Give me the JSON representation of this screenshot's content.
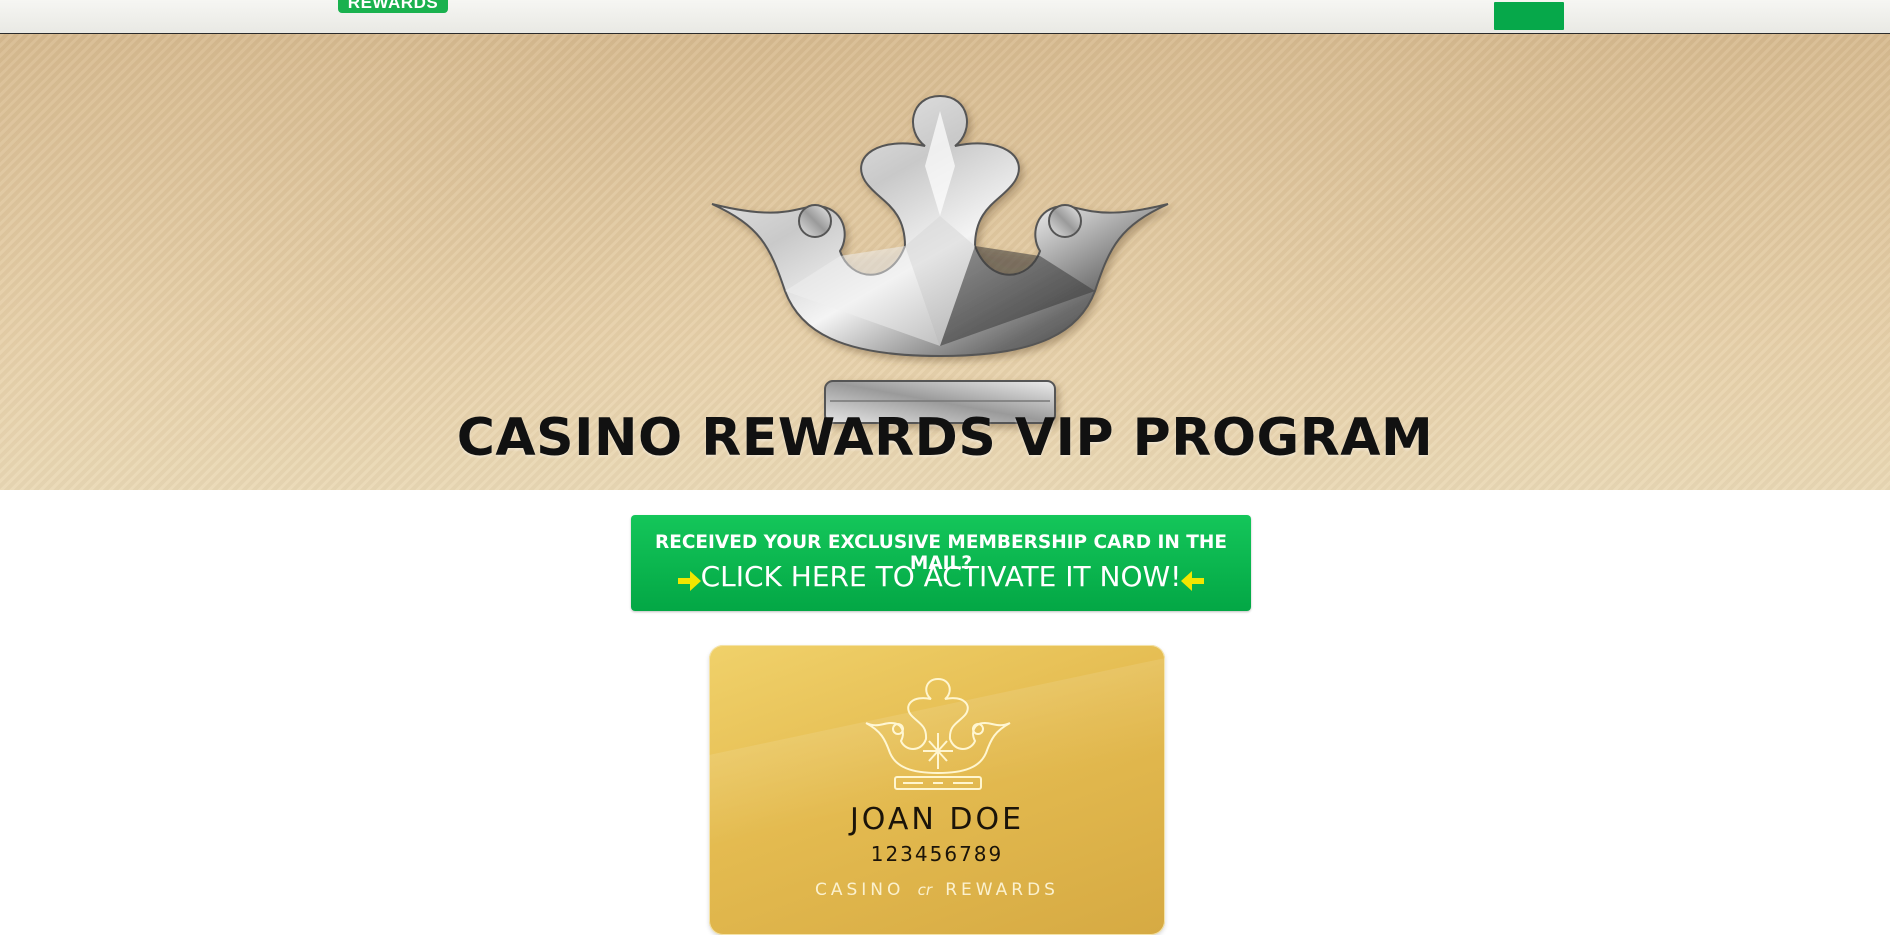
{
  "header": {
    "logo_text": "REWARDS"
  },
  "hero": {
    "title": "CASINO REWARDS VIP PROGRAM",
    "image_icon": "diamond-crown-icon"
  },
  "activation": {
    "prompt": "RECEIVED YOUR EXCLUSIVE MEMBERSHIP CARD IN THE MAIL?",
    "cta": "CLICK HERE TO ACTIVATE IT NOW!",
    "arrow_color": "#f2e600"
  },
  "card": {
    "name": "JOAN DOE",
    "number": "123456789",
    "brand_left": "CASINO",
    "brand_mark": "cr",
    "brand_right": "REWARDS"
  },
  "colors": {
    "accent_green": "#06a84a",
    "hero_tan": "#dcc29b",
    "card_gold": "#e4bb50"
  }
}
